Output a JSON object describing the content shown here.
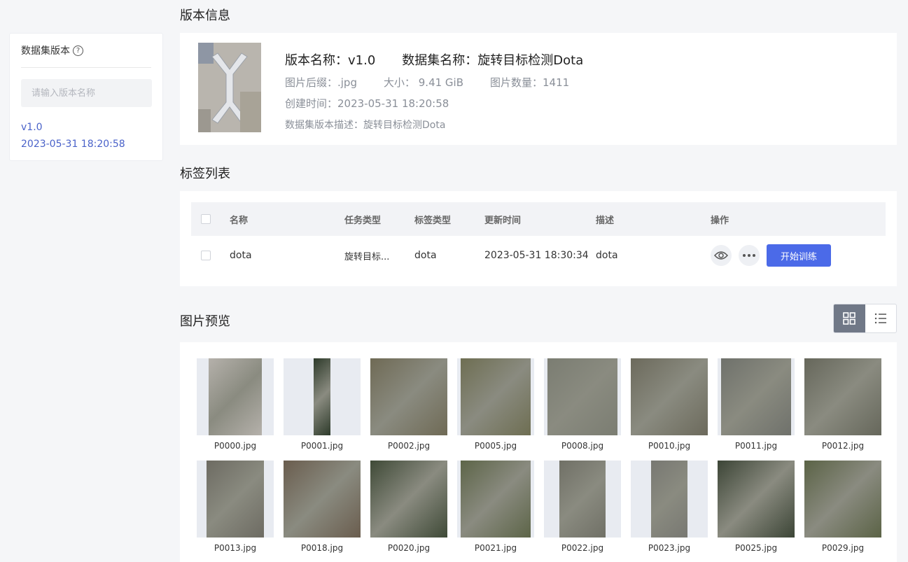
{
  "sidebar": {
    "title": "数据集版本",
    "help_glyph": "?",
    "search_placeholder": "请输入版本名称",
    "versions": [
      {
        "name": "v1.0",
        "time": "2023-05-31 18:20:58"
      }
    ]
  },
  "version_info": {
    "heading": "版本信息",
    "version_name": "版本名称：v1.0",
    "dataset_name": "数据集名称：旋转目标检测Dota",
    "suffix": "图片后缀：.jpg",
    "size": "大小： 9.41 GiB",
    "count": "图片数量：1411",
    "created": "创建时间：2023-05-31 18:20:58",
    "description": "数据集版本描述：旋转目标检测Dota"
  },
  "labels": {
    "heading": "标签列表",
    "columns": [
      "名称",
      "任务类型",
      "标签类型",
      "更新时间",
      "描述",
      "操作"
    ],
    "rows": [
      {
        "name": "dota",
        "task": "旋转目标...",
        "label_type": "dota",
        "updated": "2023-05-31 18:30:34",
        "desc": "dota",
        "action": "开始训练"
      }
    ]
  },
  "preview": {
    "heading": "图片预览",
    "view_mode": "grid",
    "images": [
      {
        "name": "P0000.jpg",
        "color": "#b5b1ab"
      },
      {
        "name": "P0001.jpg",
        "color": "#2d3a2a"
      },
      {
        "name": "P0002.jpg",
        "color": "#6f6a55"
      },
      {
        "name": "P0005.jpg",
        "color": "#6e6e52"
      },
      {
        "name": "P0008.jpg",
        "color": "#7b7d72"
      },
      {
        "name": "P0010.jpg",
        "color": "#6c6a5c"
      },
      {
        "name": "P0011.jpg",
        "color": "#6f716b"
      },
      {
        "name": "P0012.jpg",
        "color": "#66675b"
      },
      {
        "name": "P0013.jpg",
        "color": "#6d6b62"
      },
      {
        "name": "P0018.jpg",
        "color": "#6a5d4e"
      },
      {
        "name": "P0020.jpg",
        "color": "#3f4a37"
      },
      {
        "name": "P0021.jpg",
        "color": "#5d6548"
      },
      {
        "name": "P0022.jpg",
        "color": "#707066"
      },
      {
        "name": "P0023.jpg",
        "color": "#787872"
      },
      {
        "name": "P0025.jpg",
        "color": "#3c4536"
      },
      {
        "name": "P0029.jpg",
        "color": "#5b6346"
      }
    ]
  }
}
